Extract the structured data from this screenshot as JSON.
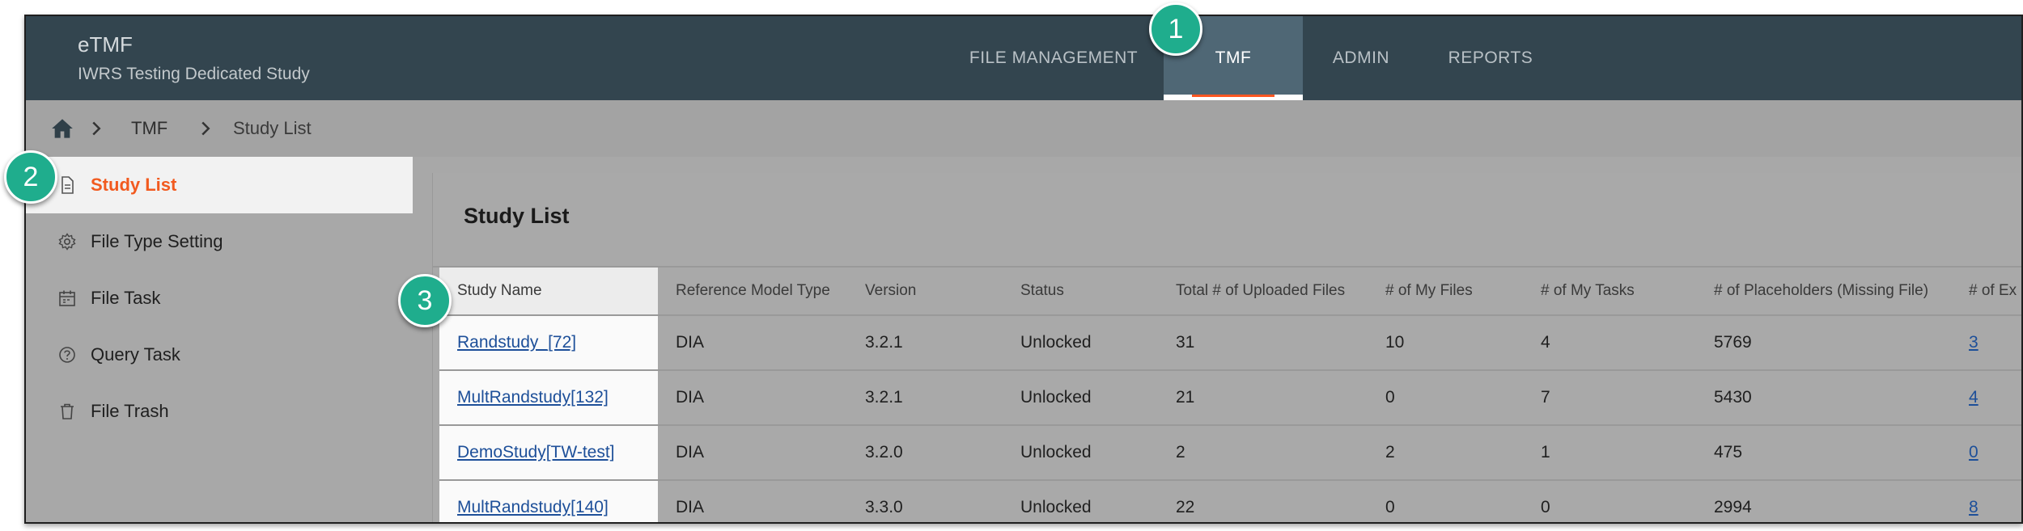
{
  "app": {
    "title": "eTMF",
    "study": "IWRS Testing Dedicated Study"
  },
  "nav": {
    "tabs": [
      {
        "label": "FILE MANAGEMENT",
        "active": false
      },
      {
        "label": "TMF",
        "active": true
      },
      {
        "label": "ADMIN",
        "active": false
      },
      {
        "label": "REPORTS",
        "active": false
      }
    ]
  },
  "breadcrumb": {
    "home_icon": "home-icon",
    "items": [
      "TMF",
      "Study List"
    ]
  },
  "sidebar": {
    "items": [
      {
        "label": "Study List",
        "icon": "document-icon",
        "active": true
      },
      {
        "label": "File Type Setting",
        "icon": "gear-icon",
        "active": false
      },
      {
        "label": "File Task",
        "icon": "calendar-icon",
        "active": false
      },
      {
        "label": "Query Task",
        "icon": "question-icon",
        "active": false
      },
      {
        "label": "File Trash",
        "icon": "trash-icon",
        "active": false
      }
    ]
  },
  "main": {
    "title": "Study List",
    "columns": [
      "Study Name",
      "Reference Model Type",
      "Version",
      "Status",
      "Total # of Uploaded Files",
      "# of My Files",
      "# of My Tasks",
      "# of Placeholders (Missing File)",
      "# of Ex"
    ],
    "rows": [
      {
        "study": "Randstudy_[72]",
        "model": "DIA",
        "version": "3.2.1",
        "status": "Unlocked",
        "uploaded": "31",
        "my_files": "10",
        "my_tasks": "4",
        "placeholders": "5769",
        "ex": "3"
      },
      {
        "study": "MultRandstudy[132]",
        "model": "DIA",
        "version": "3.2.1",
        "status": "Unlocked",
        "uploaded": "21",
        "my_files": "0",
        "my_tasks": "7",
        "placeholders": "5430",
        "ex": "4"
      },
      {
        "study": "DemoStudy[TW-test]",
        "model": "DIA",
        "version": "3.2.0",
        "status": "Unlocked",
        "uploaded": "2",
        "my_files": "2",
        "my_tasks": "1",
        "placeholders": "475",
        "ex": "0"
      },
      {
        "study": "MultRandstudy[140]",
        "model": "DIA",
        "version": "3.3.0",
        "status": "Unlocked",
        "uploaded": "22",
        "my_files": "0",
        "my_tasks": "0",
        "placeholders": "2994",
        "ex": "8"
      }
    ]
  },
  "callouts": [
    "1",
    "2",
    "3"
  ],
  "colors": {
    "header": "#33454f",
    "active_tab": "#4f6775",
    "accent": "#f25a1f",
    "badge": "#1fad8d",
    "link": "#1d4f99"
  }
}
